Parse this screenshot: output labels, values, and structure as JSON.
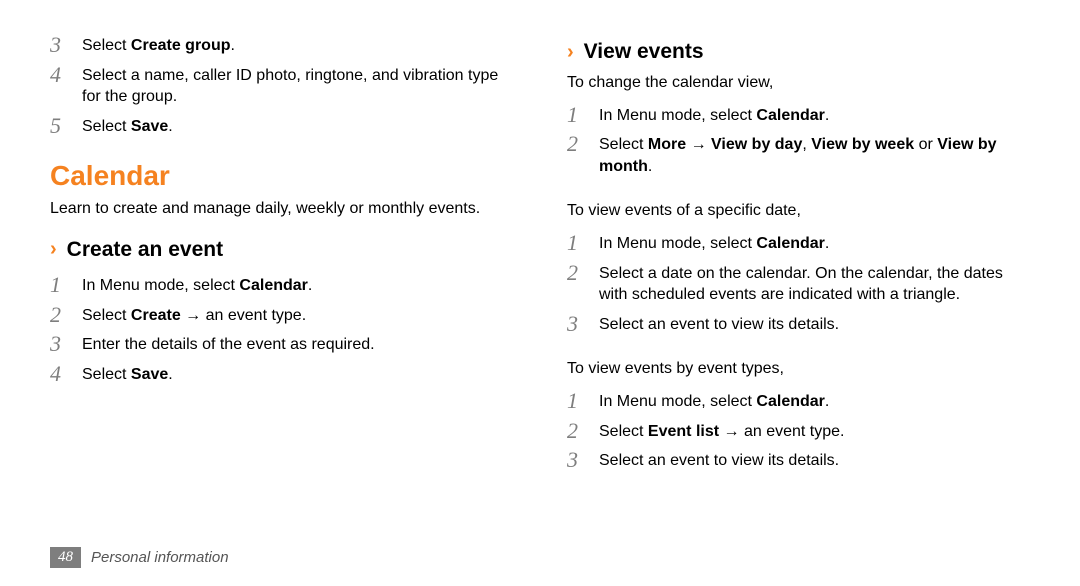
{
  "left": {
    "topSteps": [
      {
        "n": "3",
        "html": "Select <b>Create group</b>."
      },
      {
        "n": "4",
        "html": "Select a name, caller ID photo, ringtone, and vibration type for the group."
      },
      {
        "n": "5",
        "html": "Select <b>Save</b>."
      }
    ],
    "title": "Calendar",
    "lead": "Learn to create and manage daily, weekly or monthly events.",
    "subheading": "Create an event",
    "createSteps": [
      {
        "n": "1",
        "html": "In Menu mode, select <b>Calendar</b>."
      },
      {
        "n": "2",
        "html": "Select <b>Create</b> → an event type."
      },
      {
        "n": "3",
        "html": "Enter the details of the event as required."
      },
      {
        "n": "4",
        "html": "Select <b>Save</b>."
      }
    ]
  },
  "right": {
    "subheading": "View events",
    "p1": "To change the calendar view,",
    "steps1": [
      {
        "n": "1",
        "html": "In Menu mode, select <b>Calendar</b>."
      },
      {
        "n": "2",
        "html": "Select <b>More</b> → <b>View by day</b>, <b>View by week</b> or <b>View by month</b>."
      }
    ],
    "p2": "To view events of a specific date,",
    "steps2": [
      {
        "n": "1",
        "html": "In Menu mode, select <b>Calendar</b>."
      },
      {
        "n": "2",
        "html": "Select a date on the calendar. On the calendar, the dates with scheduled events are indicated with a triangle."
      },
      {
        "n": "3",
        "html": "Select an event to view its details."
      }
    ],
    "p3": "To view events by event types,",
    "steps3": [
      {
        "n": "1",
        "html": "In Menu mode, select <b>Calendar</b>."
      },
      {
        "n": "2",
        "html": "Select <b>Event list</b> → an event type."
      },
      {
        "n": "3",
        "html": "Select an event to view its details."
      }
    ]
  },
  "footer": {
    "page": "48",
    "label": "Personal information"
  }
}
